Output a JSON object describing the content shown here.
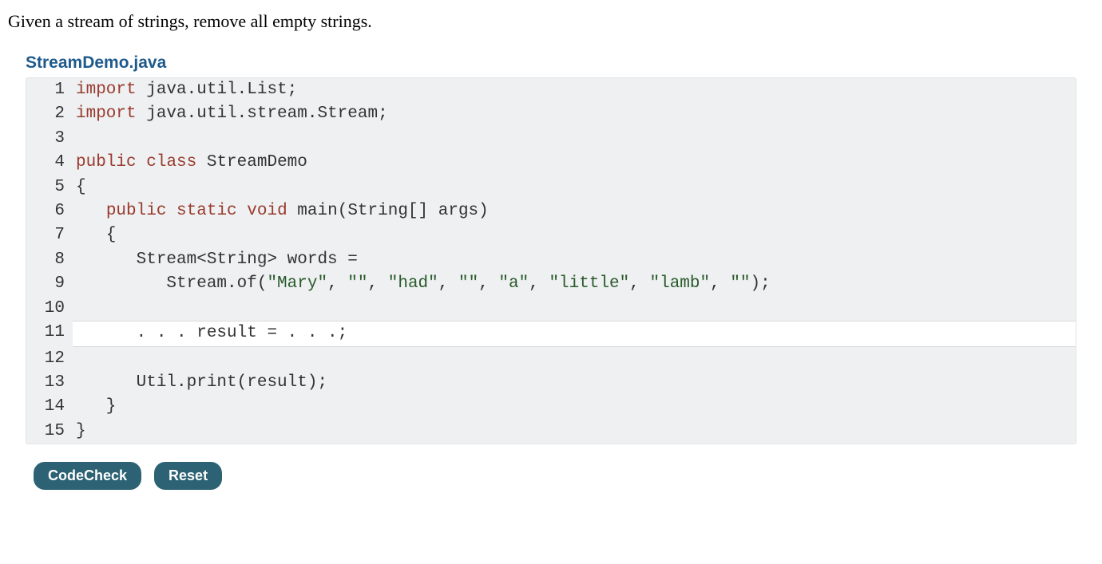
{
  "problem_text": "Given a stream of strings, remove all empty strings.",
  "filename": "StreamDemo.java",
  "code": {
    "lines": [
      {
        "n": "1",
        "kind": "static",
        "tokens": [
          [
            "kw",
            "import"
          ],
          [
            "",
            " java.util.List;"
          ]
        ]
      },
      {
        "n": "2",
        "kind": "static",
        "tokens": [
          [
            "kw",
            "import"
          ],
          [
            "",
            " java.util.stream.Stream;"
          ]
        ]
      },
      {
        "n": "3",
        "kind": "static",
        "tokens": [
          [
            "",
            ""
          ]
        ]
      },
      {
        "n": "4",
        "kind": "static",
        "tokens": [
          [
            "kw",
            "public"
          ],
          [
            "",
            " "
          ],
          [
            "kw",
            "class"
          ],
          [
            "",
            " StreamDemo"
          ]
        ]
      },
      {
        "n": "5",
        "kind": "static",
        "tokens": [
          [
            "",
            "{"
          ]
        ]
      },
      {
        "n": "6",
        "kind": "static",
        "tokens": [
          [
            "",
            "   "
          ],
          [
            "kw",
            "public"
          ],
          [
            "",
            " "
          ],
          [
            "kw",
            "static"
          ],
          [
            "",
            " "
          ],
          [
            "kw",
            "void"
          ],
          [
            "",
            " main(String[] args)"
          ]
        ]
      },
      {
        "n": "7",
        "kind": "static",
        "tokens": [
          [
            "",
            "   {"
          ]
        ]
      },
      {
        "n": "8",
        "kind": "static",
        "tokens": [
          [
            "",
            "      Stream<String> words ="
          ]
        ]
      },
      {
        "n": "9",
        "kind": "static",
        "tokens": [
          [
            "",
            "         Stream.of("
          ],
          [
            "str",
            "\"Mary\""
          ],
          [
            "",
            ", "
          ],
          [
            "str",
            "\"\""
          ],
          [
            "",
            ", "
          ],
          [
            "str",
            "\"had\""
          ],
          [
            "",
            ", "
          ],
          [
            "str",
            "\"\""
          ],
          [
            "",
            ", "
          ],
          [
            "str",
            "\"a\""
          ],
          [
            "",
            ", "
          ],
          [
            "str",
            "\"little\""
          ],
          [
            "",
            ", "
          ],
          [
            "str",
            "\"lamb\""
          ],
          [
            "",
            ", "
          ],
          [
            "str",
            "\"\""
          ],
          [
            "",
            ");"
          ]
        ]
      },
      {
        "n": "10",
        "kind": "static",
        "tokens": [
          [
            "",
            ""
          ]
        ]
      },
      {
        "n": "11",
        "kind": "editable",
        "text": "      . . . result = . . .;"
      },
      {
        "n": "12",
        "kind": "static",
        "tokens": [
          [
            "",
            ""
          ]
        ]
      },
      {
        "n": "13",
        "kind": "static",
        "tokens": [
          [
            "",
            "      Util.print(result);"
          ]
        ]
      },
      {
        "n": "14",
        "kind": "static",
        "tokens": [
          [
            "",
            "   }"
          ]
        ]
      },
      {
        "n": "15",
        "kind": "static",
        "tokens": [
          [
            "",
            "}"
          ]
        ]
      }
    ]
  },
  "buttons": {
    "codecheck": "CodeCheck",
    "reset": "Reset"
  }
}
